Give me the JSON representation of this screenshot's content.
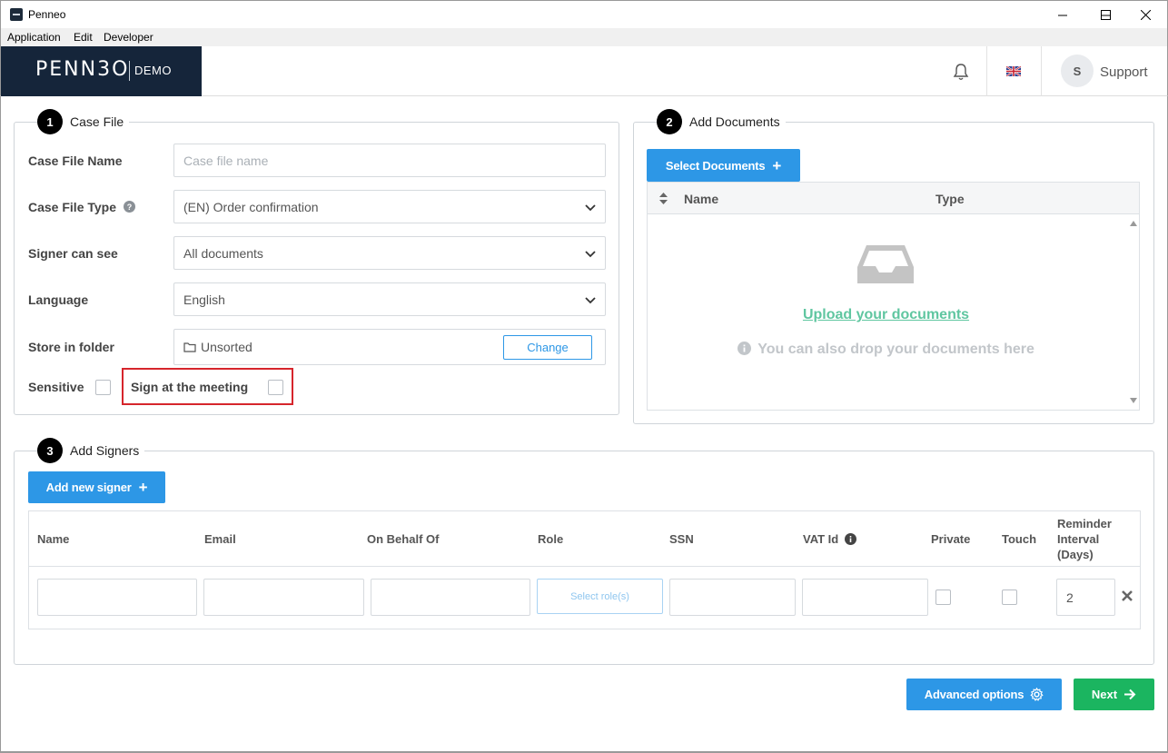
{
  "window": {
    "title": "Penneo",
    "minimize_glyph": "—",
    "maximize_glyph": "☐",
    "close_glyph": "✕"
  },
  "menu": {
    "items": [
      "Application",
      "Edit",
      "Developer"
    ]
  },
  "header": {
    "logo_text": "PENN3O",
    "logo_demo": "DEMO",
    "avatar_initial": "S",
    "support_label": "Support",
    "icons": [
      "bell-icon",
      "uk-flag-icon"
    ]
  },
  "case_file": {
    "step": "1",
    "title": "Case File",
    "name_label": "Case File Name",
    "name_placeholder": "Case file name",
    "type_label": "Case File Type",
    "type_value": "(EN) Order confirmation",
    "signer_see_label": "Signer can see",
    "signer_see_value": "All documents",
    "language_label": "Language",
    "language_value": "English",
    "folder_label": "Store in folder",
    "folder_value": "Unsorted",
    "change_button": "Change",
    "sensitive_label": "Sensitive",
    "sign_meeting_label": "Sign at the meeting"
  },
  "documents": {
    "step": "2",
    "title": "Add Documents",
    "select_button": "Select Documents",
    "col_name": "Name",
    "col_type": "Type",
    "upload_link": "Upload your documents",
    "drop_hint": "You can also drop your documents here"
  },
  "signers": {
    "step": "3",
    "title": "Add Signers",
    "add_button": "Add new signer",
    "columns": {
      "name": "Name",
      "email": "Email",
      "on_behalf": "On Behalf Of",
      "role": "Role",
      "ssn": "SSN",
      "vat": "VAT Id",
      "private": "Private",
      "touch": "Touch",
      "reminder_1": "Reminder",
      "reminder_2": "Interval",
      "reminder_3": "(Days)"
    },
    "row": {
      "role_placeholder": "Select role(s)",
      "reminder_value": "2"
    }
  },
  "footer": {
    "advanced_button": "Advanced options",
    "next_button": "Next"
  },
  "colors": {
    "primary": "#2d97e6",
    "success": "#1bb560",
    "highlight": "#d6252c",
    "link": "#5fc6a0",
    "logo_bg": "#15253a"
  }
}
